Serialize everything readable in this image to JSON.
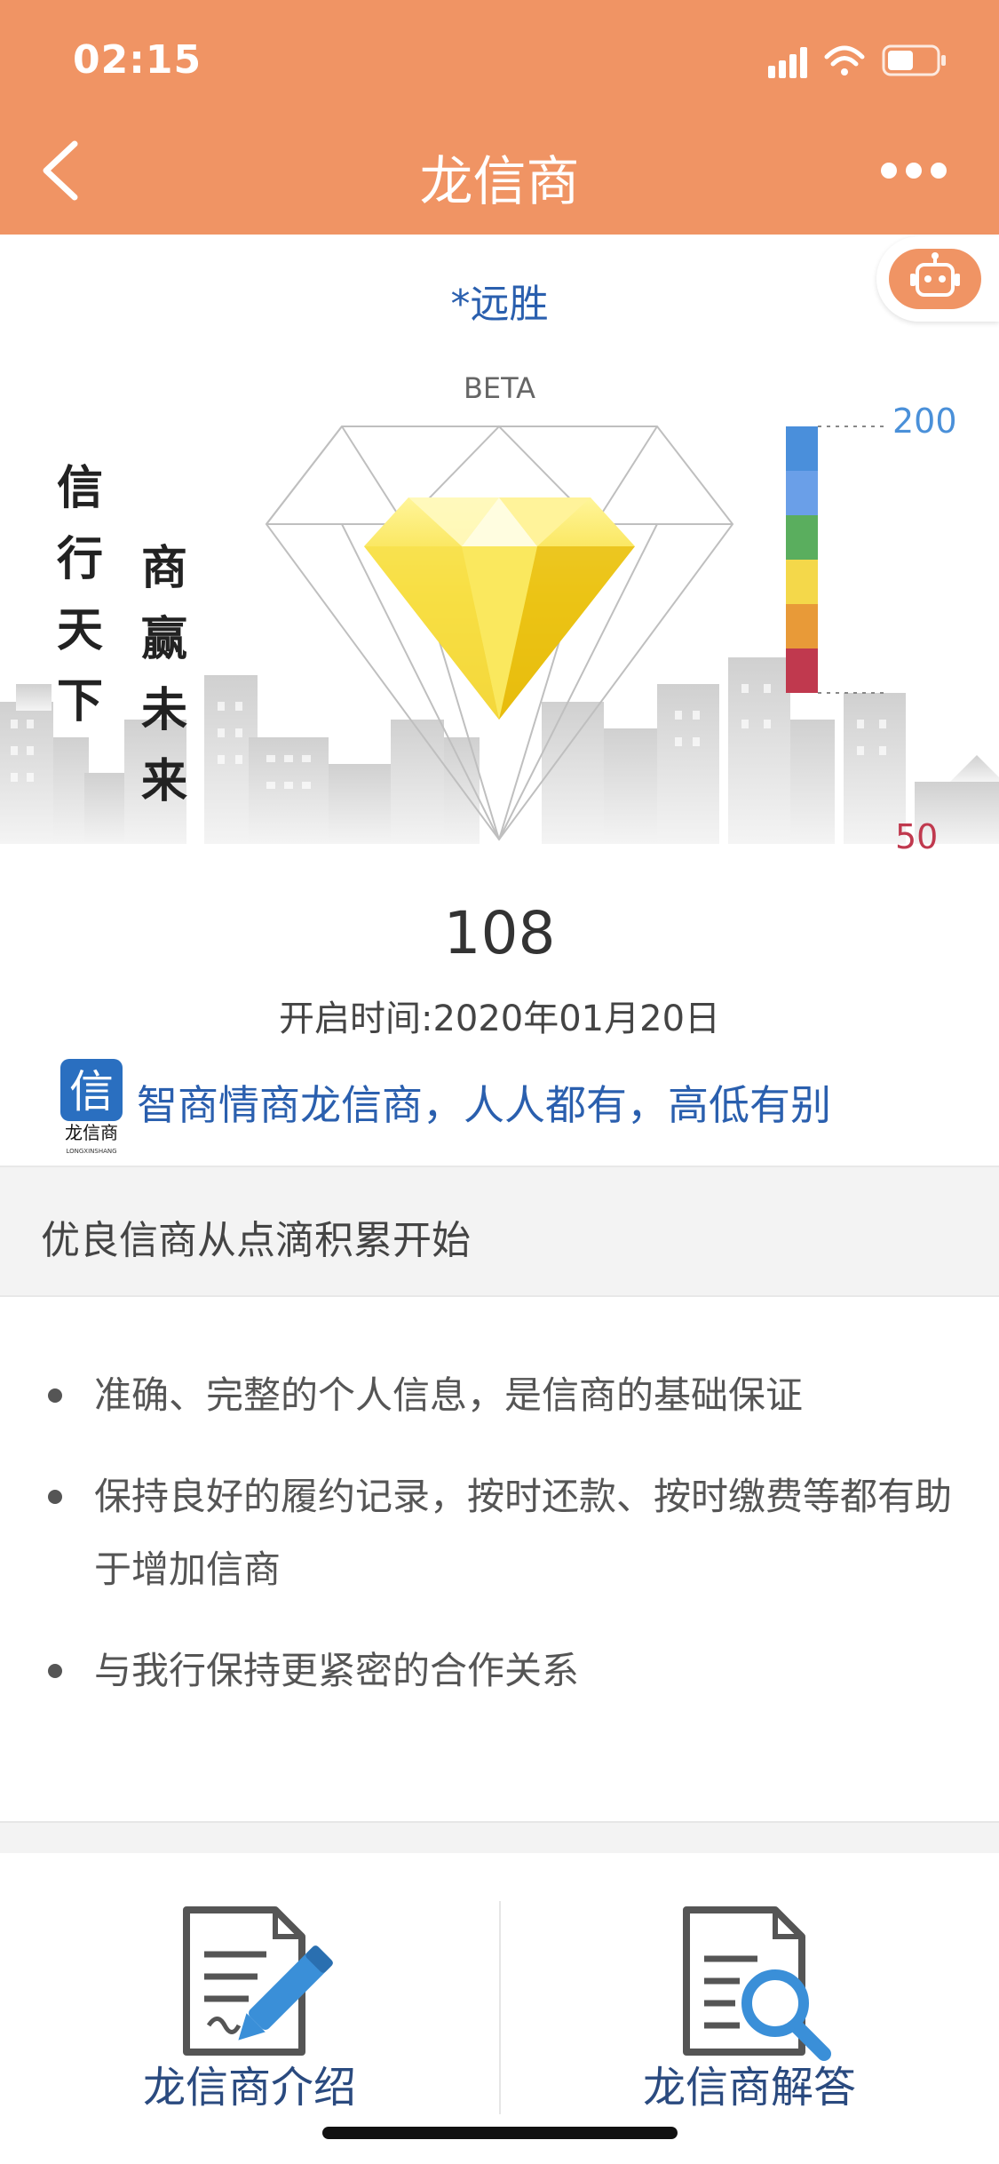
{
  "status_bar": {
    "time": "02:15"
  },
  "nav": {
    "title": "龙信商"
  },
  "header": {
    "user_name": "*远胜",
    "beta": "BETA"
  },
  "banner": {
    "calligraphy_left": "信行天下",
    "calligraphy_right": "商赢未来",
    "scale_max": "200",
    "scale_min": "50",
    "scale_colors": [
      "#4A8FDB",
      "#6A9FE8",
      "#5AAE5E",
      "#F4D84A",
      "#E89A38",
      "#C0394E"
    ]
  },
  "score": {
    "value": "108",
    "open_label": "开启时间:",
    "open_date": "2020年01月20日"
  },
  "slogan": {
    "logo_text": "龙信商",
    "logo_sub": "LONGXINSHANG",
    "text": "智商情商龙信商，人人都有，高低有别"
  },
  "section": {
    "title": "优良信商从点滴积累开始"
  },
  "tips": [
    {
      "text": "准确、完整的个人信息，是信商的基础保证"
    },
    {
      "text": "保持良好的履约记录，按时还款、按时缴费等都有助于增加信商"
    },
    {
      "text": "与我行保持更紧密的合作关系"
    }
  ],
  "cards": [
    {
      "label": "龙信商介绍",
      "icon": "document-pen-icon"
    },
    {
      "label": "龙信商解答",
      "icon": "document-search-icon"
    }
  ]
}
